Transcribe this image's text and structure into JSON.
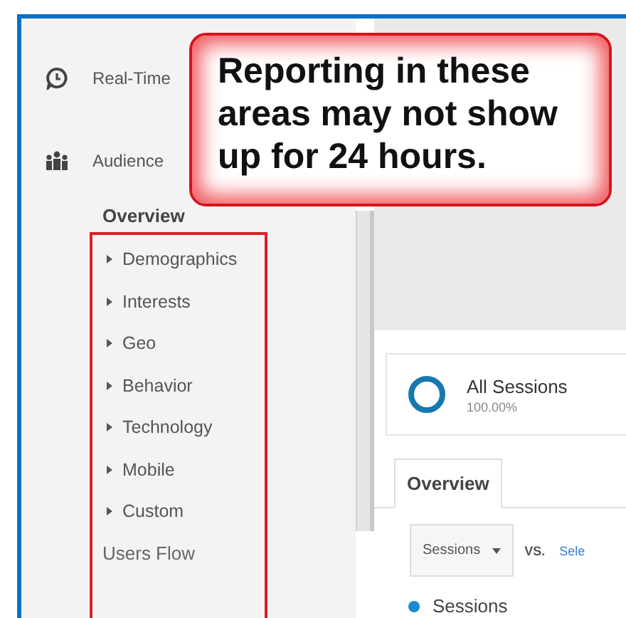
{
  "sidebar": {
    "sections": [
      {
        "label": "Real-Time"
      },
      {
        "label": "Audience",
        "children": [
          {
            "label": "Overview",
            "kind": "link",
            "selected": true
          },
          {
            "label": "Demographics",
            "kind": "expandable",
            "expanded": false,
            "selected": false
          },
          {
            "label": "Interests",
            "kind": "expandable",
            "expanded": false,
            "selected": false
          },
          {
            "label": "Geo",
            "kind": "expandable",
            "expanded": false,
            "selected": false
          },
          {
            "label": "Behavior",
            "kind": "expandable",
            "expanded": false,
            "selected": false
          },
          {
            "label": "Technology",
            "kind": "expandable",
            "expanded": false,
            "selected": false
          },
          {
            "label": "Mobile",
            "kind": "expandable",
            "expanded": false,
            "selected": false
          },
          {
            "label": "Custom",
            "kind": "expandable",
            "expanded": false,
            "selected": false
          },
          {
            "label": "Users Flow",
            "kind": "link",
            "selected": false
          }
        ]
      }
    ]
  },
  "callout": {
    "text": "Reporting in these areas may not show up for 24 hours."
  },
  "segment": {
    "name": "All Sessions",
    "share": "100.00%"
  },
  "tabs": [
    {
      "label": "Overview",
      "selected": true
    }
  ],
  "metric_selector": {
    "value": "Sessions"
  },
  "vs_label": "VS.",
  "select_link": "Sele",
  "legend": [
    {
      "label": "Sessions",
      "color": "#1a8ad0"
    }
  ]
}
